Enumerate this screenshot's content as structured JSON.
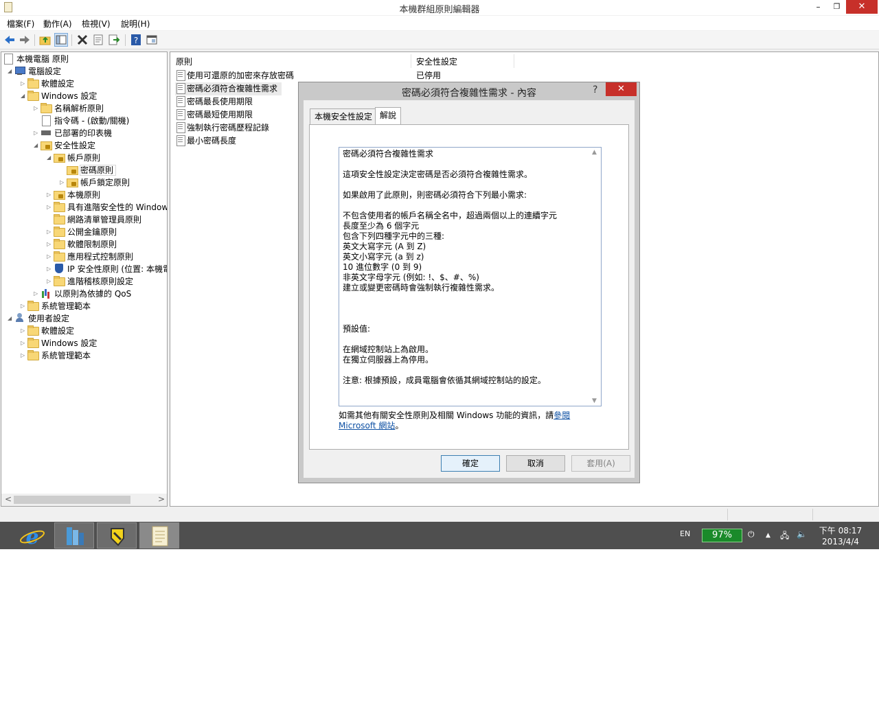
{
  "window": {
    "title": "本機群組原則編輯器",
    "min_glyph": "–",
    "max_glyph": "❐",
    "close_glyph": "✕"
  },
  "menu": [
    "檔案(F)",
    "動作(A)",
    "檢視(V)",
    "說明(H)"
  ],
  "toolbar": [
    "back-icon",
    "forward-icon",
    "up-folder-icon",
    "show-hide-tree-icon",
    "delete-icon",
    "properties-icon",
    "export-list-icon",
    "help-icon",
    "console-icon"
  ],
  "tree": {
    "root": "本機電腦 原則",
    "computer_config": "電腦設定",
    "software_settings": "軟體設定",
    "windows_settings": "Windows 設定",
    "name_resolution_policy": "名稱解析原則",
    "scripts": "指令碼 - (啟動/關機)",
    "deployed_printers": "已部署的印表機",
    "security_settings": "安全性設定",
    "account_policies": "帳戶原則",
    "password_policy": "密碼原則",
    "account_lockout_policy": "帳戶鎖定原則",
    "local_policies": "本機原則",
    "advanced_firewall": "具有進階安全性的 Windows",
    "network_list_manager": "網路清單管理員原則",
    "public_key_policies": "公開金鑰原則",
    "software_restriction": "軟體限制原則",
    "app_control": "應用程式控制原則",
    "ip_security": "IP 安全性原則 (位置: 本機電",
    "advanced_audit": "進階稽核原則設定",
    "qos": "以原則為依據的 QoS",
    "admin_templates": "系統管理範本",
    "user_config": "使用者設定",
    "user_software_settings": "軟體設定",
    "user_windows_settings": "Windows 設定",
    "user_admin_templates": "系統管理範本",
    "scroll_left": "<",
    "scroll_right": ">"
  },
  "list": {
    "col_policy": "原則",
    "col_setting": "安全性設定",
    "rows": [
      {
        "name": "使用可還原的加密來存放密碼",
        "value": "已停用"
      },
      {
        "name": "密碼必須符合複雜性需求",
        "value": ""
      },
      {
        "name": "密碼最長使用期限",
        "value": ""
      },
      {
        "name": "密碼最短使用期限",
        "value": ""
      },
      {
        "name": "強制執行密碼歷程記錄",
        "value": ""
      },
      {
        "name": "最小密碼長度",
        "value": ""
      }
    ]
  },
  "dialog": {
    "title": "密碼必須符合複雜性需求 - 內容",
    "help": "?",
    "close": "✕",
    "tab_local": "本機安全性設定",
    "tab_explain": "解說",
    "explain_lines": [
      "密碼必須符合複雜性需求",
      "",
      "這項安全性設定決定密碼是否必須符合複雜性需求。",
      "",
      "如果啟用了此原則，則密碼必須符合下列最小需求:",
      "",
      "不包含使用者的帳戶名稱全名中，超過兩個以上的連續字元",
      "長度至少為 6 個字元",
      "包含下列四種字元中的三種:",
      "英文大寫字元 (A 到 Z)",
      "英文小寫字元 (a 到 z)",
      "10 進位數字 (0 到 9)",
      "非英文字母字元 (例如: !、$、#、%)",
      "建立或變更密碼時會強制執行複雜性需求。",
      "",
      "",
      "",
      "預設值:",
      "",
      "在網域控制站上為啟用。",
      "在獨立伺服器上為停用。",
      "",
      "注意: 根據預設，成員電腦會依循其網域控制站的設定。"
    ],
    "more_info_prefix": "如需其他有關安全性原則及相關 Windows 功能的資訊，請",
    "more_info_link": "參閱 Microsoft 網站",
    "more_info_suffix": "。",
    "ok": "確定",
    "cancel": "取消",
    "apply": "套用(A)"
  },
  "taskbar": {
    "apps": [
      "internet-explorer-icon",
      "server-manager-icon",
      "sticky-app-icon",
      "notepad-icon"
    ],
    "lang": "EN",
    "battery": "97%",
    "time": "下午 08:17",
    "date": "2013/4/4"
  }
}
